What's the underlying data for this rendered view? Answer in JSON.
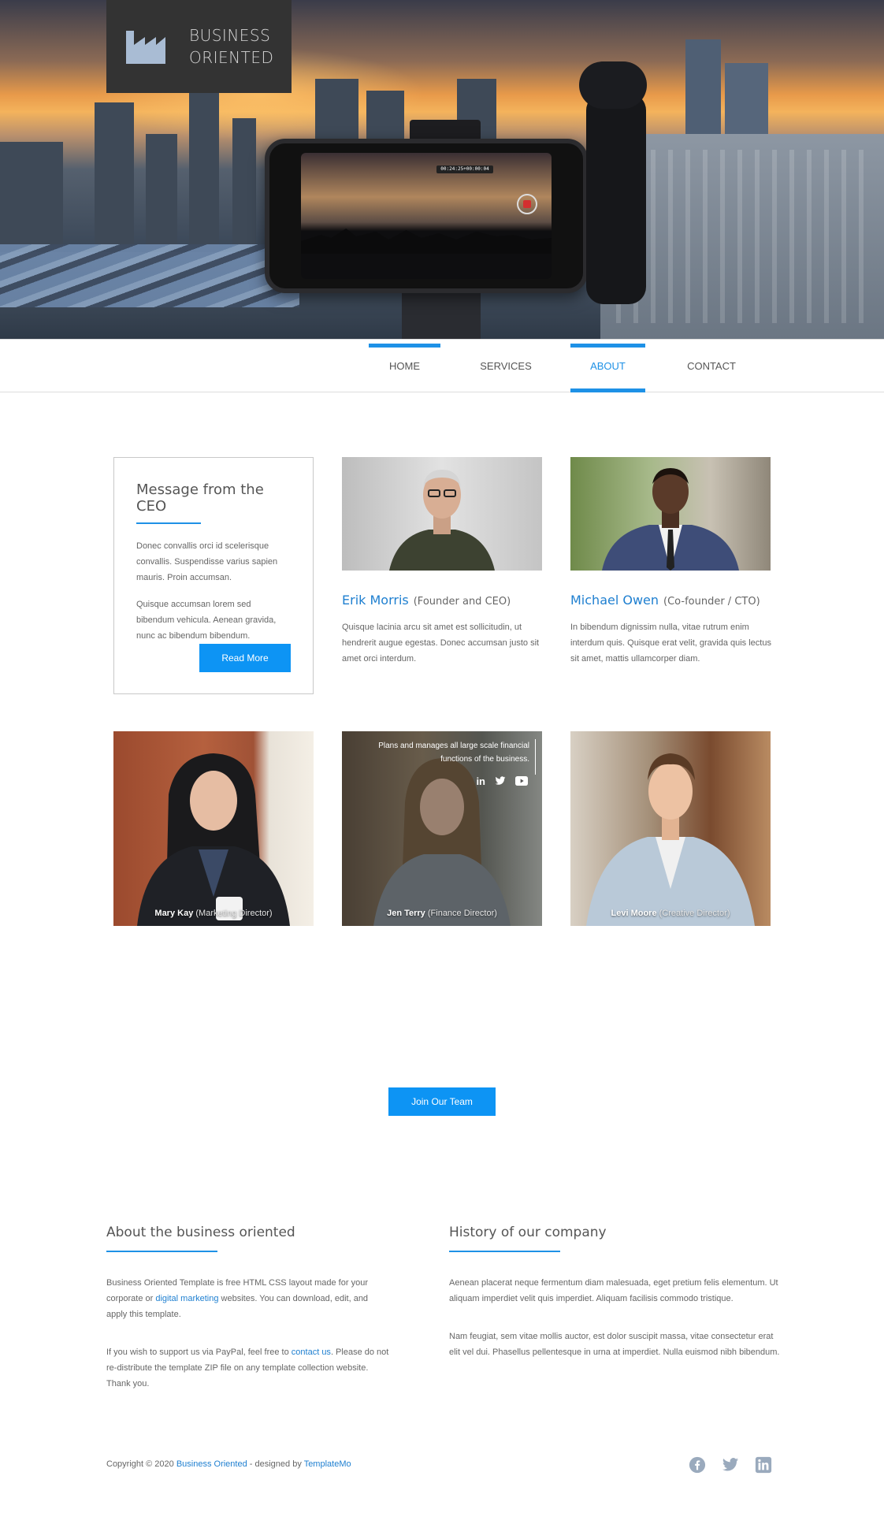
{
  "brand": {
    "line1": "BUSINESS",
    "line2": "ORIENTED"
  },
  "hero": {
    "recording_time": "00:24:25+00:00:04"
  },
  "nav": {
    "items": [
      {
        "label": "HOME"
      },
      {
        "label": "SERVICES"
      },
      {
        "label": "ABOUT"
      },
      {
        "label": "CONTACT"
      }
    ],
    "active": "ABOUT"
  },
  "ceo_card": {
    "title": "Message from the CEO",
    "p1": "Donec convallis orci id scelerisque convallis. Suspendisse varius sapien mauris. Proin accumsan.",
    "p2": "Quisque accumsan lorem sed bibendum vehicula. Aenean gravida, nunc ac bibendum bibendum.",
    "button": "Read More"
  },
  "founders": [
    {
      "name": "Erik Morris",
      "role": "(Founder and CEO)",
      "desc": "Quisque lacinia arcu sit amet est sollicitudin, ut hendrerit augue egestas. Donec accumsan justo sit amet orci interdum."
    },
    {
      "name": "Michael Owen",
      "role": "(Co-founder / CTO)",
      "desc": "In bibendum dignissim nulla, vitae rutrum enim interdum quis. Quisque erat velit, gravida quis lectus sit amet, mattis ullamcorper diam."
    }
  ],
  "team": [
    {
      "name": "Mary Kay",
      "role": "(Marketing Director)"
    },
    {
      "name": "Jen Terry",
      "role": "(Finance Director)",
      "overlay": "Plans and manages all large scale financial functions of the business."
    },
    {
      "name": "Levi Moore",
      "role": "(Creative Director)"
    }
  ],
  "join_button": "Join Our Team",
  "footer": {
    "about": {
      "title": "About the business oriented",
      "p1_a": "Business Oriented Template is free HTML CSS layout made for your corporate or ",
      "p1_link": "digital marketing",
      "p1_b": " websites. You can download, edit, and apply this template.",
      "p2_a": "If you wish to support us via PayPal, feel free to ",
      "p2_link": "contact us",
      "p2_b": ". Please do not re-distribute the template ZIP file on any template collection website. Thank you."
    },
    "history": {
      "title": "History of our company",
      "p1": "Aenean placerat neque fermentum diam malesuada, eget pretium felis elementum. Ut aliquam imperdiet velit quis imperdiet. Aliquam facilisis commodo tristique.",
      "p2": "Nam feugiat, sem vitae mollis auctor, est dolor suscipit massa, vitae consectetur erat elit vel dui. Phasellus pellentesque in urna at imperdiet. Nulla euismod nibh bibendum."
    },
    "copyright_a": "Copyright © 2020 ",
    "copyright_link1": "Business Oriented",
    "copyright_b": " - designed by ",
    "copyright_link2": "TemplateMo"
  },
  "colors": {
    "accent": "#1e91e6",
    "button": "#0d94f4",
    "logo_bg": "#333333",
    "social": "#9aaabd"
  }
}
